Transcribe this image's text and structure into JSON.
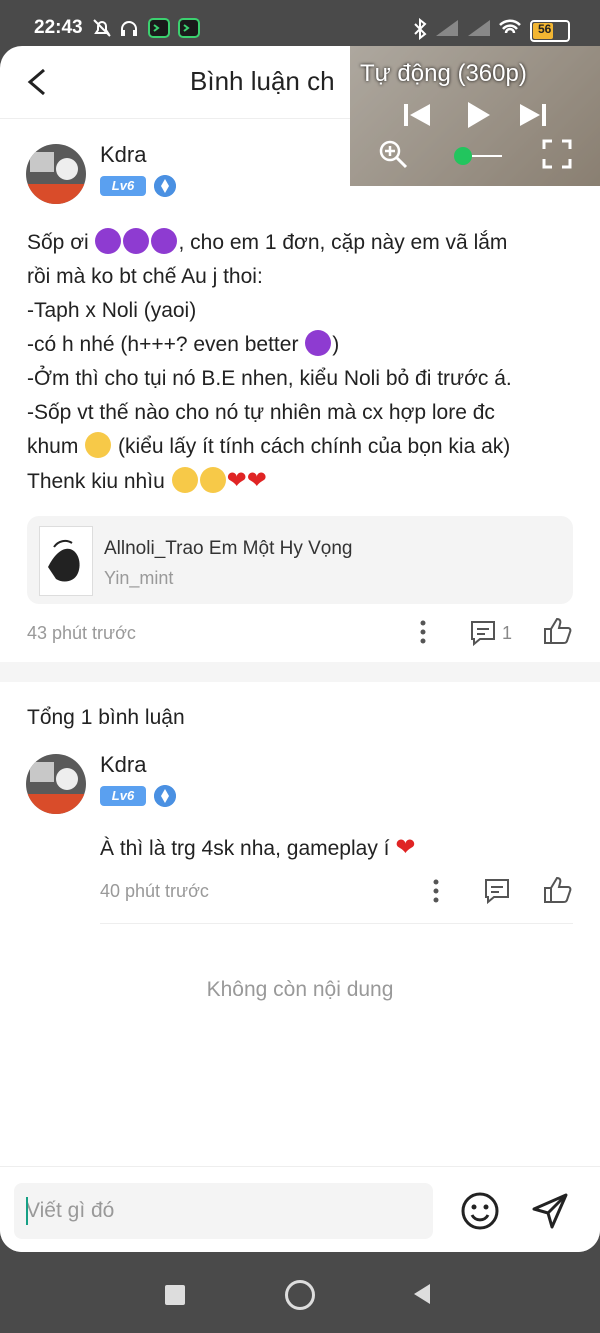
{
  "status": {
    "time": "22:43",
    "battery": "56"
  },
  "header": {
    "title": "Bình luận ch"
  },
  "video": {
    "quality_label": "Tự động (360p)"
  },
  "post": {
    "username": "Kdra",
    "level": "Lv6",
    "lines": [
      "Sốp ơi",
      ", cho em 1 đơn, cặp này em vã lắm",
      "rồi mà ko bt chế Au j thoi:",
      "-Taph x Noli (yaoi)",
      "-có h nhé (h+++? even better",
      ")",
      "-Ởm thì cho tụi nó B.E nhen, kiểu Noli bỏ đi trước á.",
      "-Sốp vt thế nào cho nó tự nhiên mà cx hợp lore đc",
      "khum",
      " (kiểu lấy ít tính cách chính của bọn kia ak)",
      "Thenk kiu nhìu"
    ],
    "story": {
      "title": "Allnoli_Trao Em Một Hy Vọng",
      "author": "Yin_mint"
    },
    "time": "43 phút trước",
    "comment_count": "1"
  },
  "replies": {
    "total": "Tổng 1 bình luận",
    "items": [
      {
        "username": "Kdra",
        "level": "Lv6",
        "text": "À thì là trg 4sk nha, gameplay í",
        "time": "40 phút trước"
      }
    ],
    "end_text": "Không còn nội dung"
  },
  "composer": {
    "placeholder": "Viết gì đó"
  },
  "colors": {
    "accent": "#5aa0f0",
    "cursor": "#16a085"
  }
}
